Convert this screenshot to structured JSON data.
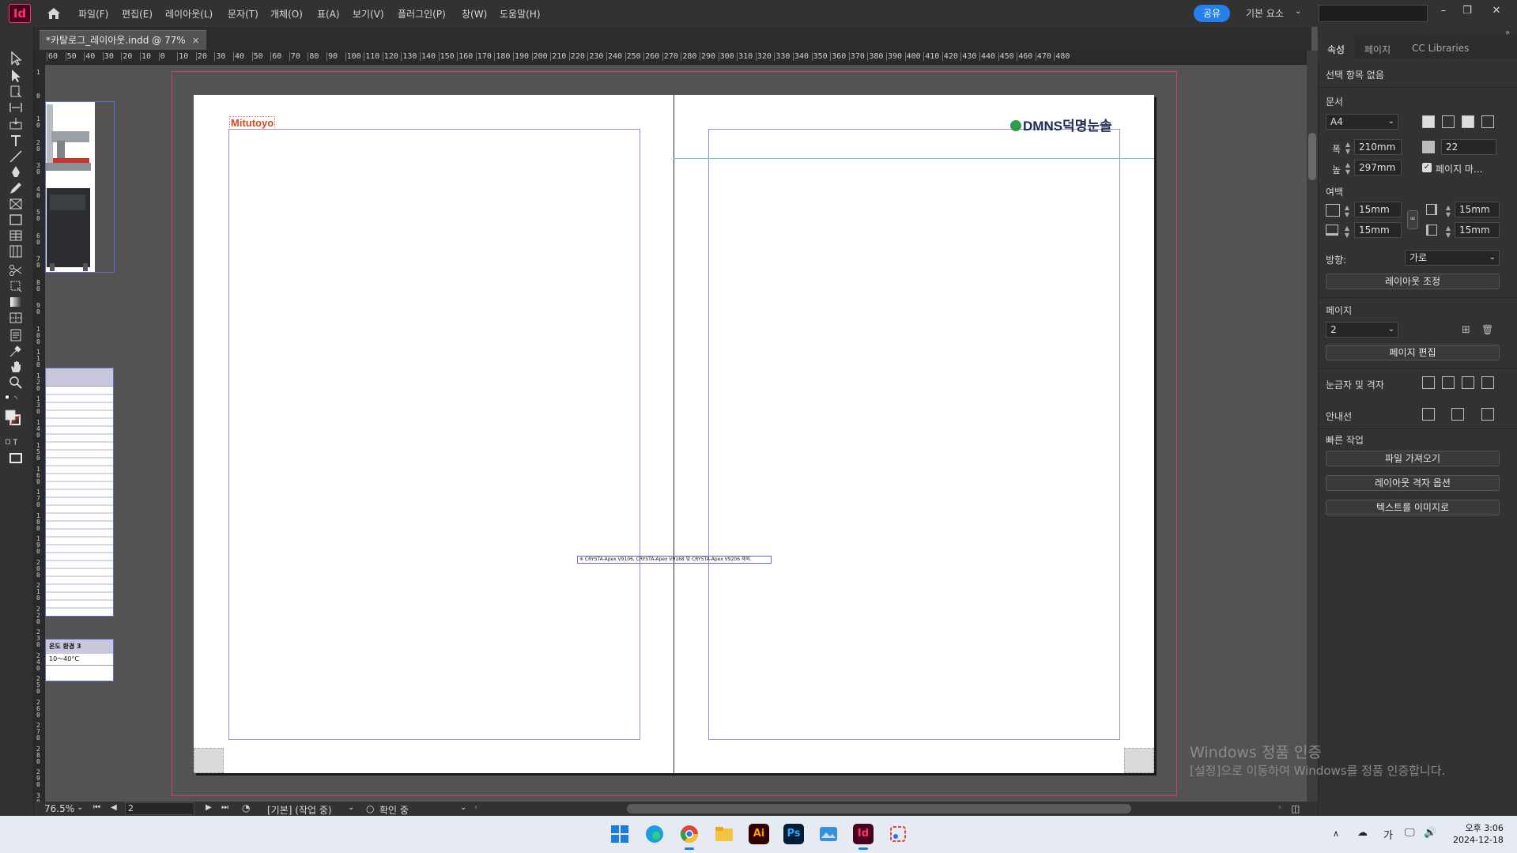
{
  "app": {
    "logo": "Id",
    "home_icon": "home-icon"
  },
  "menu": [
    "파일(F)",
    "편집(E)",
    "레이아웃(L)",
    "문자(T)",
    "개체(O)",
    "표(A)",
    "보기(V)",
    "플러그인(P)",
    "창(W)",
    "도움말(H)"
  ],
  "header": {
    "share": "공유",
    "workspace": "기본 요소"
  },
  "document_tab": {
    "title": "*카탈로그_레이아웃.indd @ 77%",
    "close": "×"
  },
  "ruler_h_labels": [
    "60",
    "50",
    "40",
    "30",
    "20",
    "10",
    "0",
    "10",
    "20",
    "30",
    "40",
    "50",
    "60",
    "70",
    "80",
    "90",
    "100",
    "110",
    "120",
    "130",
    "140",
    "150",
    "160",
    "170",
    "180",
    "190",
    "200",
    "210",
    "220",
    "230",
    "240",
    "250",
    "260",
    "270",
    "280",
    "290",
    "300",
    "310",
    "320",
    "330",
    "340",
    "350",
    "360",
    "370",
    "380",
    "390",
    "400",
    "410",
    "420",
    "430",
    "440",
    "450",
    "460",
    "470",
    "480"
  ],
  "ruler_v_labels": [
    "1",
    "0",
    "1 0",
    "2 0",
    "3 0",
    "4 0",
    "5 0",
    "6 0",
    "7 0",
    "8 0",
    "9 0",
    "1 0 0",
    "1 1 0",
    "1 2 0",
    "1 3 0",
    "1 4 0",
    "1 5 0",
    "1 6 0",
    "1 7 0",
    "1 8 0",
    "1 9 0",
    "2 0 0",
    "2 1 0",
    "2 2 0",
    "2 3 0",
    "2 4 0",
    "2 5 0",
    "2 6 0",
    "2 7 0",
    "2 8 0",
    "2 9 0",
    "3 0 0"
  ],
  "page_content": {
    "left_logo": "Mitutoyo",
    "right_logo": "DMNS덕명눈솔",
    "caption": "※ CRYSTA-Apex V9106, CRYSTA-Apex V9168 및 CRYSTA-Apex V9206 제외."
  },
  "pasteboard": {
    "temp_table_header": "온도 환경 3",
    "temp_table_value": "10～40°C"
  },
  "panel": {
    "tabs": [
      "속성",
      "페이지",
      "CC Libraries"
    ],
    "selection": "선택 항목 없음",
    "document_label": "문서",
    "page_size": "A4",
    "width_label": "폭",
    "width": "210mm",
    "height_label": "높",
    "height": "297mm",
    "pages_count": "22",
    "facing_pages": "페이지 마...",
    "margins_label": "여백",
    "margin_top": "15mm",
    "margin_bottom": "15mm",
    "margin_left": "15mm",
    "margin_right": "15mm",
    "orientation_label": "방향:",
    "orientation": "가로",
    "adjust_layout": "레이아웃 조정",
    "page_label": "페이지",
    "page_value": "2",
    "edit_page": "페이지 편집",
    "rulers_grid": "눈금자 및 격자",
    "guides": "안내선",
    "quick_actions": "빠른 작업",
    "import_file": "파일 가져오기",
    "layout_grid_options": "레이아웃 격자 옵션",
    "text_to_image": "텍스트를 이미지로"
  },
  "status": {
    "zoom": "76.5%",
    "page": "2",
    "style": "[기본] (작업 중)",
    "preflight": "확인 중"
  },
  "watermark": {
    "line1": "Windows 정품 인증",
    "line2": "[설정]으로 이동하여 Windows를 정품 인증합니다."
  },
  "taskbar": {
    "ime": "가",
    "time": "오후 3:06",
    "date": "2024-12-18"
  },
  "colors": {
    "accent": "#2680eb",
    "indesign": "#ff3366",
    "bleed": "#d1425b",
    "margin": "#9b8ed8"
  }
}
